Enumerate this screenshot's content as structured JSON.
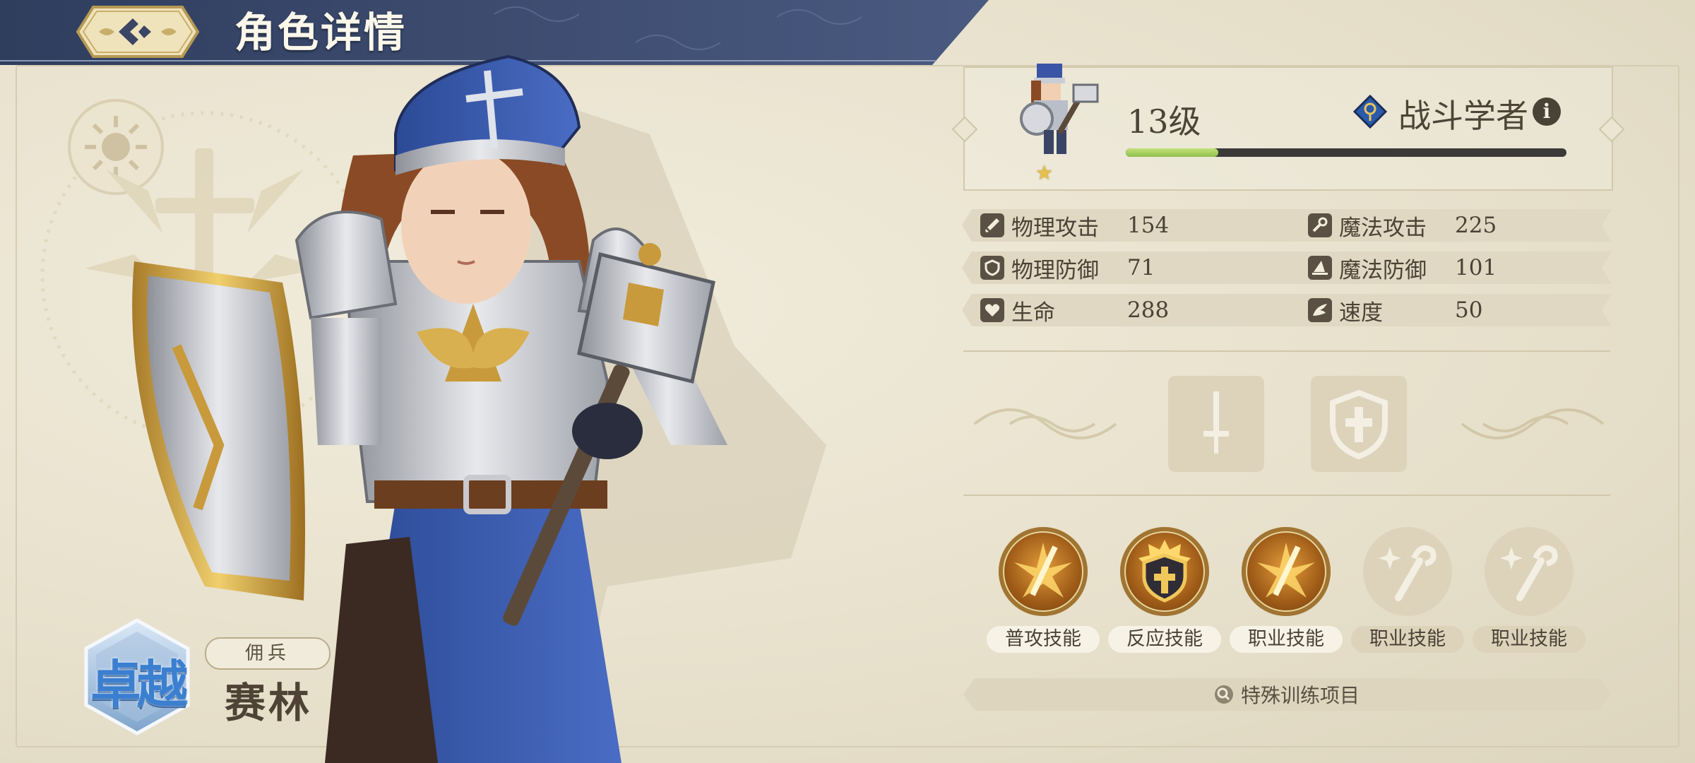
{
  "header": {
    "title": "角色详情"
  },
  "character": {
    "rank": "卓越",
    "type": "佣兵",
    "name": "赛林",
    "level": "13级",
    "class_name": "战斗学者",
    "xp_progress": 0.21
  },
  "stats": [
    {
      "label": "物理攻击",
      "value": "154",
      "icon": "sword-icon"
    },
    {
      "label": "魔法攻击",
      "value": "225",
      "icon": "wand-icon"
    },
    {
      "label": "物理防御",
      "value": "71",
      "icon": "shield-icon"
    },
    {
      "label": "魔法防御",
      "value": "101",
      "icon": "wizard-hat-icon"
    },
    {
      "label": "生命",
      "value": "288",
      "icon": "heart-icon"
    },
    {
      "label": "速度",
      "value": "50",
      "icon": "wing-icon"
    }
  ],
  "equipment": [
    {
      "slot": "weapon",
      "icon": "sword-icon"
    },
    {
      "slot": "armor",
      "icon": "cross-shield-icon"
    }
  ],
  "skills": [
    {
      "label": "普攻技能",
      "active": true,
      "icon": "slash-burst-icon"
    },
    {
      "label": "反应技能",
      "active": true,
      "icon": "shield-burst-icon"
    },
    {
      "label": "职业技能",
      "active": true,
      "icon": "slash-burst-icon"
    },
    {
      "label": "职业技能",
      "active": false,
      "icon": "staff-sparkle-icon"
    },
    {
      "label": "职业技能",
      "active": false,
      "icon": "staff-sparkle-icon"
    }
  ],
  "training": {
    "label": "特殊训练项目",
    "icon": "search-icon"
  },
  "colors": {
    "header_band": "#3a4a6e",
    "xp_fill": "#a8d163",
    "accent_gold": "#c89a3b"
  }
}
